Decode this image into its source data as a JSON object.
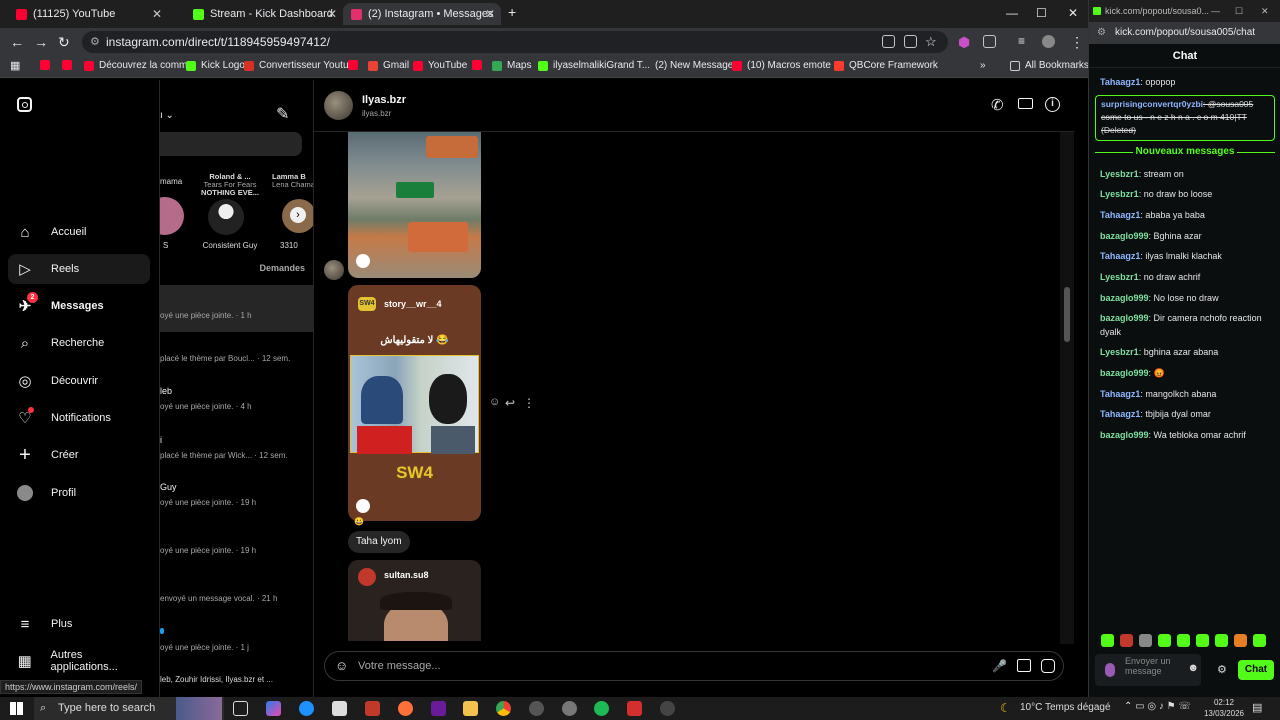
{
  "browser": {
    "tabs": [
      {
        "title": "(11125) YouTube",
        "color": "#ff0033",
        "active": false
      },
      {
        "title": "Stream - Kick Dashboard",
        "color": "#53fc18",
        "active": false
      },
      {
        "title": "(2) Instagram • Messages",
        "color": "#e1306c",
        "active": true
      }
    ],
    "new_tab": "+",
    "url": "instagram.com/direct/t/118945959497412/",
    "bookmarks": [
      {
        "label": "",
        "color": "#ff0033"
      },
      {
        "label": "",
        "color": "#ff0033"
      },
      {
        "label": "Découvrez la comm...",
        "color": "#ff0033"
      },
      {
        "label": "Kick Logo",
        "color": "#53fc18"
      },
      {
        "label": "Convertisseur Youtu...",
        "color": "#d93025"
      },
      {
        "label": "",
        "color": "#ff0033"
      },
      {
        "label": "Gmail",
        "color": "#ea4335"
      },
      {
        "label": "YouTube",
        "color": "#ff0033"
      },
      {
        "label": "",
        "color": "#ff0033"
      },
      {
        "label": "Maps",
        "color": "#34a853"
      },
      {
        "label": "ilyaselmalikiGrand T...",
        "color": "#53fc18"
      },
      {
        "label": "(2) New Messages!",
        "color": "#000000"
      },
      {
        "label": "(10) Macros emote r...",
        "color": "#ff0033"
      },
      {
        "label": "QBCore Framework",
        "color": "#ff3b30"
      }
    ],
    "all_bookmarks": "All Bookmarks",
    "status_url": "https://www.instagram.com/reels/"
  },
  "instagram": {
    "nav": [
      {
        "label": "Accueil",
        "icon": "home-icon",
        "glyph": "⌂"
      },
      {
        "label": "Reels",
        "icon": "reels-icon",
        "glyph": "▷"
      },
      {
        "label": "Messages",
        "icon": "messenger-icon",
        "glyph": "✈",
        "badge": "2"
      },
      {
        "label": "Recherche",
        "icon": "search-icon",
        "glyph": "⌕"
      },
      {
        "label": "Découvrir",
        "icon": "compass-icon",
        "glyph": "◎"
      },
      {
        "label": "Notifications",
        "icon": "heart-icon",
        "glyph": "♡"
      },
      {
        "label": "Créer",
        "icon": "plus-icon",
        "glyph": "+"
      },
      {
        "label": "Profil",
        "icon": "avatar-icon",
        "glyph": ""
      }
    ],
    "nav_bottom": [
      {
        "label": "Plus",
        "icon": "menu-icon",
        "glyph": "≡"
      },
      {
        "label": "Autres applications...",
        "icon": "apps-icon",
        "glyph": "▦"
      }
    ],
    "notes": [
      {
        "title": "mama",
        "subtitle": "",
        "name": "S"
      },
      {
        "title": "Roland & ...",
        "subtitle": "Tears For Fears",
        "extra": "NOTHING EVE...",
        "name": "Consistent Guy"
      },
      {
        "title": "Lamma B",
        "subtitle": "Lena Chamar",
        "name": "3310"
      }
    ],
    "requests_label": "Demandes",
    "conversations": [
      {
        "name": "",
        "preview": "oyé une pièce jointe. · 1 h"
      },
      {
        "name": "",
        "preview": "placé le thème par Boucl... · 12 sem."
      },
      {
        "name": "leb",
        "preview": "oyé une pièce jointe. · 4 h"
      },
      {
        "name": "i",
        "preview": "placé le thème par Wick... · 12 sem."
      },
      {
        "name": "Guy",
        "preview": "oyé une pièce jointe. · 19 h"
      },
      {
        "name": "",
        "preview": "oyé une pièce jointe. · 19 h"
      },
      {
        "name": "",
        "preview": "envoyé un message vocal. · 21 h"
      },
      {
        "name": "",
        "preview": "oyé une pièce jointe. · 1 j"
      },
      {
        "name": "",
        "preview": "leb, Zouhir Idrissi, Ilyas.bzr et ..."
      }
    ],
    "chat": {
      "name": "Ilyas.bzr",
      "handle": "ilyas.bzr",
      "post_author": "story__wr__4",
      "post_caption": "لا متقوليهاش 😂",
      "post_tag": "SW4",
      "message": "Taha lyom",
      "second_post_author": "sultan.su8",
      "composer_placeholder": "Votre message..."
    }
  },
  "kick": {
    "window_title": "kick.com/popout/sousa0...",
    "url": "kick.com/popout/sousa005/chat",
    "chat_title": "Chat",
    "top_message": {
      "user": "Tahaagz1",
      "text": ": opopop"
    },
    "pinned": {
      "user": "surprisingconvertqr0yzbi",
      "text": ": @sousa005 come to us - n e z h n a . c o m 410|TT (Deleted)"
    },
    "new_messages_label": "Nouveaux messages",
    "messages": [
      {
        "user": "Lyesbzr1",
        "color": "#7ee0a0",
        "text": ": stream on"
      },
      {
        "user": "Lyesbzr1",
        "color": "#7ee0a0",
        "text": ": no draw bo loose"
      },
      {
        "user": "Tahaagz1",
        "color": "#8eb8ff",
        "text": ": ababa ya baba"
      },
      {
        "user": "bazaglo999",
        "color": "#7ee0a0",
        "text": ": Bghina azar"
      },
      {
        "user": "Tahaagz1",
        "color": "#8eb8ff",
        "text": ": ilyas lmalki klachak"
      },
      {
        "user": "Lyesbzr1",
        "color": "#7ee0a0",
        "text": ": no draw achrif"
      },
      {
        "user": "bazaglo999",
        "color": "#7ee0a0",
        "text": ": No lose no draw"
      },
      {
        "user": "bazaglo999",
        "color": "#7ee0a0",
        "text": ": Dir camera nchofo reaction dyalk"
      },
      {
        "user": "Lyesbzr1",
        "color": "#7ee0a0",
        "text": ": bghina azar abana"
      },
      {
        "user": "bazaglo999",
        "color": "#7ee0a0",
        "text": ": 😡"
      },
      {
        "user": "Tahaagz1",
        "color": "#8eb8ff",
        "text": ": mangolkch abana"
      },
      {
        "user": "Tahaagz1",
        "color": "#8eb8ff",
        "text": ": tbjbija dyal omar"
      },
      {
        "user": "bazaglo999",
        "color": "#7ee0a0",
        "text": ": Wa tebloka omar achrif"
      }
    ],
    "input_placeholder": "Envoyer un message",
    "send_label": "Chat"
  },
  "taskbar": {
    "search_placeholder": "Type here to search",
    "weather": "10°C  Temps dégagé",
    "time": "02:12",
    "date": "13/03/2026"
  }
}
